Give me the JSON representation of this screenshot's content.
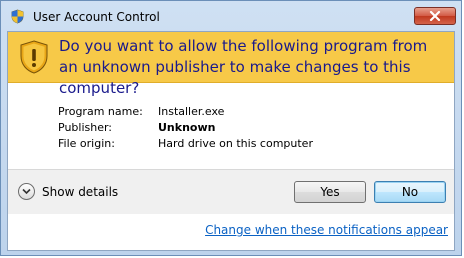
{
  "window": {
    "title": "User Account Control",
    "close_icon": "close-icon"
  },
  "banner": {
    "icon": "shield-warning-icon",
    "headline": "Do you want to allow the following program from an unknown publisher to make changes to this computer?"
  },
  "details": {
    "program_name_label": "Program name:",
    "program_name_value": "Installer.exe",
    "publisher_label": "Publisher:",
    "publisher_value": "Unknown",
    "file_origin_label": "File origin:",
    "file_origin_value": "Hard drive on this computer"
  },
  "footer": {
    "show_details_label": "Show details",
    "yes_label": "Yes",
    "no_label": "No"
  },
  "link": {
    "label": "Change when these notifications appear"
  },
  "colors": {
    "banner": "#f7c948",
    "headline_text": "#1a1a8c",
    "link": "#0b62c4"
  }
}
